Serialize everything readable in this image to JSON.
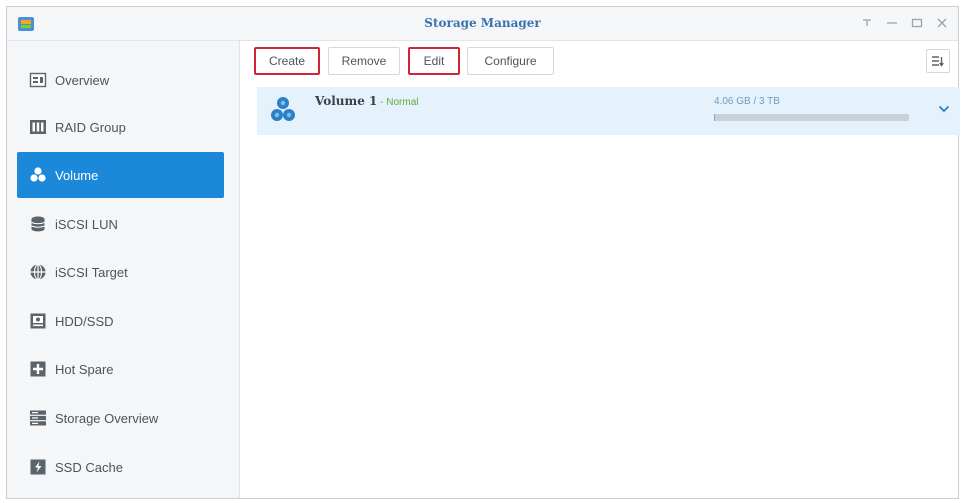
{
  "window": {
    "title": "Storage Manager",
    "controls": [
      "help-icon",
      "minimize-icon",
      "maximize-icon",
      "close-icon"
    ]
  },
  "sidebar": {
    "items": [
      {
        "label": "Overview",
        "icon": "overview-icon"
      },
      {
        "label": "RAID Group",
        "icon": "raid-group-icon"
      },
      {
        "label": "Volume",
        "icon": "volume-icon",
        "active": true
      },
      {
        "label": "iSCSI LUN",
        "icon": "iscsi-lun-icon"
      },
      {
        "label": "iSCSI Target",
        "icon": "iscsi-target-icon"
      },
      {
        "label": "HDD/SSD",
        "icon": "hdd-ssd-icon"
      },
      {
        "label": "Hot Spare",
        "icon": "hot-spare-icon"
      },
      {
        "label": "Storage Overview",
        "icon": "storage-overview-icon"
      },
      {
        "label": "SSD Cache",
        "icon": "ssd-cache-icon"
      }
    ]
  },
  "toolbar": {
    "create_label": "Create",
    "remove_label": "Remove",
    "edit_label": "Edit",
    "configure_label": "Configure"
  },
  "volumes": [
    {
      "name": "Volume 1",
      "separator": " - ",
      "status": "Normal",
      "usage": "4.06 GB / 3 TB",
      "used_fraction": 0.001
    }
  ],
  "colors": {
    "accent": "#1c88da",
    "title": "#3a72b0",
    "status_ok": "#5fae3d",
    "highlight_border": "#d0243a",
    "row_bg": "#e5f1fb"
  }
}
